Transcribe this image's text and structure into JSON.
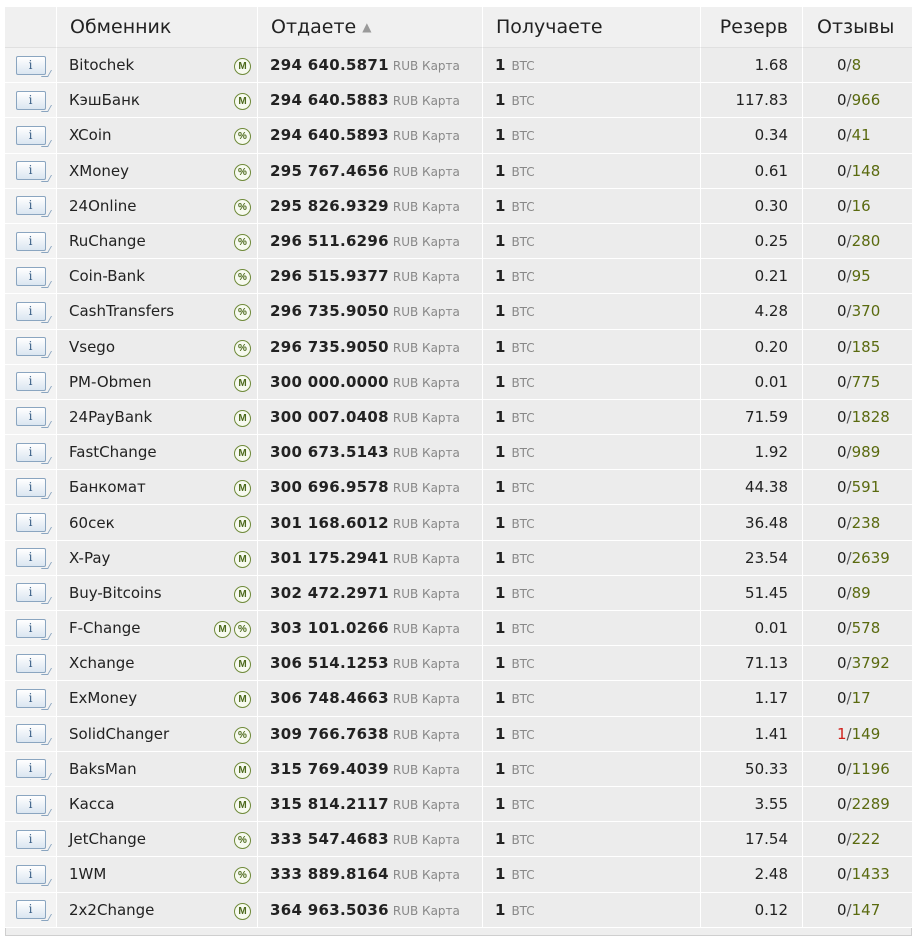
{
  "columns": {
    "exchanger": "Обменник",
    "give": "Отдаете",
    "sort_indicator": "▲",
    "get": "Получаете",
    "reserve": "Резерв",
    "reviews": "Отзывы"
  },
  "info_label": "i",
  "badge_labels": {
    "manual": "M",
    "percent": "%"
  },
  "rows": [
    {
      "name": "Bitochek",
      "badges": [
        "manual"
      ],
      "give": "294 640.5871",
      "give_cur": "RUB Карта",
      "get": "1",
      "get_cur": "BTC",
      "reserve": "1.68",
      "neg": "0",
      "pos": "8",
      "neg_red": false
    },
    {
      "name": "КэшБанк",
      "badges": [
        "manual"
      ],
      "give": "294 640.5883",
      "give_cur": "RUB Карта",
      "get": "1",
      "get_cur": "BTC",
      "reserve": "117.83",
      "neg": "0",
      "pos": "966",
      "neg_red": false
    },
    {
      "name": "XCoin",
      "badges": [
        "percent"
      ],
      "give": "294 640.5893",
      "give_cur": "RUB Карта",
      "get": "1",
      "get_cur": "BTC",
      "reserve": "0.34",
      "neg": "0",
      "pos": "41",
      "neg_red": false
    },
    {
      "name": "XMoney",
      "badges": [
        "percent"
      ],
      "give": "295 767.4656",
      "give_cur": "RUB Карта",
      "get": "1",
      "get_cur": "BTC",
      "reserve": "0.61",
      "neg": "0",
      "pos": "148",
      "neg_red": false
    },
    {
      "name": "24Online",
      "badges": [
        "percent"
      ],
      "give": "295 826.9329",
      "give_cur": "RUB Карта",
      "get": "1",
      "get_cur": "BTC",
      "reserve": "0.30",
      "neg": "0",
      "pos": "16",
      "neg_red": false
    },
    {
      "name": "RuChange",
      "badges": [
        "percent"
      ],
      "give": "296 511.6296",
      "give_cur": "RUB Карта",
      "get": "1",
      "get_cur": "BTC",
      "reserve": "0.25",
      "neg": "0",
      "pos": "280",
      "neg_red": false
    },
    {
      "name": "Coin-Bank",
      "badges": [
        "percent"
      ],
      "give": "296 515.9377",
      "give_cur": "RUB Карта",
      "get": "1",
      "get_cur": "BTC",
      "reserve": "0.21",
      "neg": "0",
      "pos": "95",
      "neg_red": false
    },
    {
      "name": "CashTransfers",
      "badges": [
        "percent"
      ],
      "give": "296 735.9050",
      "give_cur": "RUB Карта",
      "get": "1",
      "get_cur": "BTC",
      "reserve": "4.28",
      "neg": "0",
      "pos": "370",
      "neg_red": false
    },
    {
      "name": "Vsego",
      "badges": [
        "percent"
      ],
      "give": "296 735.9050",
      "give_cur": "RUB Карта",
      "get": "1",
      "get_cur": "BTC",
      "reserve": "0.20",
      "neg": "0",
      "pos": "185",
      "neg_red": false
    },
    {
      "name": "PM-Obmen",
      "badges": [
        "manual"
      ],
      "give": "300 000.0000",
      "give_cur": "RUB Карта",
      "get": "1",
      "get_cur": "BTC",
      "reserve": "0.01",
      "neg": "0",
      "pos": "775",
      "neg_red": false
    },
    {
      "name": "24PayBank",
      "badges": [
        "manual"
      ],
      "give": "300 007.0408",
      "give_cur": "RUB Карта",
      "get": "1",
      "get_cur": "BTC",
      "reserve": "71.59",
      "neg": "0",
      "pos": "1828",
      "neg_red": false
    },
    {
      "name": "FastChange",
      "badges": [
        "manual"
      ],
      "give": "300 673.5143",
      "give_cur": "RUB Карта",
      "get": "1",
      "get_cur": "BTC",
      "reserve": "1.92",
      "neg": "0",
      "pos": "989",
      "neg_red": false
    },
    {
      "name": "Банкомат",
      "badges": [
        "manual"
      ],
      "give": "300 696.9578",
      "give_cur": "RUB Карта",
      "get": "1",
      "get_cur": "BTC",
      "reserve": "44.38",
      "neg": "0",
      "pos": "591",
      "neg_red": false
    },
    {
      "name": "60сек",
      "badges": [
        "manual"
      ],
      "give": "301 168.6012",
      "give_cur": "RUB Карта",
      "get": "1",
      "get_cur": "BTC",
      "reserve": "36.48",
      "neg": "0",
      "pos": "238",
      "neg_red": false
    },
    {
      "name": "X-Pay",
      "badges": [
        "manual"
      ],
      "give": "301 175.2941",
      "give_cur": "RUB Карта",
      "get": "1",
      "get_cur": "BTC",
      "reserve": "23.54",
      "neg": "0",
      "pos": "2639",
      "neg_red": false
    },
    {
      "name": "Buy-Bitcoins",
      "badges": [
        "manual"
      ],
      "give": "302 472.2971",
      "give_cur": "RUB Карта",
      "get": "1",
      "get_cur": "BTC",
      "reserve": "51.45",
      "neg": "0",
      "pos": "89",
      "neg_red": false
    },
    {
      "name": "F-Change",
      "badges": [
        "manual",
        "percent"
      ],
      "give": "303 101.0266",
      "give_cur": "RUB Карта",
      "get": "1",
      "get_cur": "BTC",
      "reserve": "0.01",
      "neg": "0",
      "pos": "578",
      "neg_red": false
    },
    {
      "name": "Xchange",
      "badges": [
        "manual"
      ],
      "give": "306 514.1253",
      "give_cur": "RUB Карта",
      "get": "1",
      "get_cur": "BTC",
      "reserve": "71.13",
      "neg": "0",
      "pos": "3792",
      "neg_red": false
    },
    {
      "name": "ExMoney",
      "badges": [
        "manual"
      ],
      "give": "306 748.4663",
      "give_cur": "RUB Карта",
      "get": "1",
      "get_cur": "BTC",
      "reserve": "1.17",
      "neg": "0",
      "pos": "17",
      "neg_red": false
    },
    {
      "name": "SolidChanger",
      "badges": [
        "percent"
      ],
      "give": "309 766.7638",
      "give_cur": "RUB Карта",
      "get": "1",
      "get_cur": "BTC",
      "reserve": "1.41",
      "neg": "1",
      "pos": "149",
      "neg_red": true
    },
    {
      "name": "BaksMan",
      "badges": [
        "manual"
      ],
      "give": "315 769.4039",
      "give_cur": "RUB Карта",
      "get": "1",
      "get_cur": "BTC",
      "reserve": "50.33",
      "neg": "0",
      "pos": "1196",
      "neg_red": false
    },
    {
      "name": "Касса",
      "badges": [
        "manual"
      ],
      "give": "315 814.2117",
      "give_cur": "RUB Карта",
      "get": "1",
      "get_cur": "BTC",
      "reserve": "3.55",
      "neg": "0",
      "pos": "2289",
      "neg_red": false
    },
    {
      "name": "JetChange",
      "badges": [
        "percent"
      ],
      "give": "333 547.4683",
      "give_cur": "RUB Карта",
      "get": "1",
      "get_cur": "BTC",
      "reserve": "17.54",
      "neg": "0",
      "pos": "222",
      "neg_red": false
    },
    {
      "name": "1WM",
      "badges": [
        "percent"
      ],
      "give": "333 889.8164",
      "give_cur": "RUB Карта",
      "get": "1",
      "get_cur": "BTC",
      "reserve": "2.48",
      "neg": "0",
      "pos": "1433",
      "neg_red": false
    },
    {
      "name": "2x2Change",
      "badges": [
        "manual"
      ],
      "give": "364 963.5036",
      "give_cur": "RUB Карта",
      "get": "1",
      "get_cur": "BTC",
      "reserve": "0.12",
      "neg": "0",
      "pos": "147",
      "neg_red": false
    }
  ]
}
